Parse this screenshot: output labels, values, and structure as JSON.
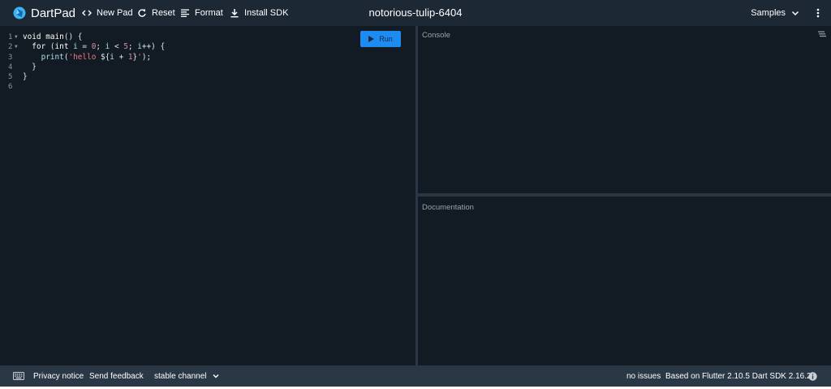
{
  "header": {
    "logo_text": "DartPad",
    "new_pad_label": "New Pad",
    "reset_label": "Reset",
    "format_label": "Format",
    "install_sdk_label": "Install SDK",
    "pad_title": "notorious-tulip-6404",
    "samples_label": "Samples"
  },
  "editor": {
    "run_label": "Run",
    "line_numbers": [
      "1",
      "2",
      "3",
      "4",
      "5",
      "6"
    ],
    "code": {
      "l1_kw": "void",
      "l1_fn": "main",
      "l1_rest": "() {",
      "l2_indent": "  ",
      "l2_for": "for",
      "l2_open": " (",
      "l2_int": "int",
      "l2_sp": " ",
      "l2_i1": "i",
      "l2_eq": " = ",
      "l2_zero": "0",
      "l2_semi1": "; ",
      "l2_i2": "i",
      "l2_lt": " < ",
      "l2_five": "5",
      "l2_semi2": "; ",
      "l2_i3": "i",
      "l2_end": "++) {",
      "l3_indent": "    ",
      "l3_print": "print",
      "l3_paren": "(",
      "l3_str1": "'hello ",
      "l3_interp_open": "${",
      "l3_i": "i",
      "l3_plus": " + ",
      "l3_one": "1",
      "l3_interp_close": "}",
      "l3_str2": "'",
      "l3_end": ");",
      "l4": "  }",
      "l5": "}",
      "l6": ""
    }
  },
  "console": {
    "label": "Console"
  },
  "documentation": {
    "label": "Documentation"
  },
  "footer": {
    "privacy_label": "Privacy notice",
    "feedback_label": "Send feedback",
    "channel_label": "stable channel",
    "issues_label": "no issues",
    "version_label": "Based on Flutter 2.10.5 Dart SDK 2.16.2"
  },
  "icons": {
    "logo": "dart-logo-icon",
    "new_pad": "code-brackets-icon",
    "reset": "refresh-icon",
    "format": "format-lines-icon",
    "install": "download-icon",
    "samples": "chevron-down-icon",
    "more": "more-vert-icon",
    "run": "play-icon",
    "console_clear": "clear-all-icon",
    "keyboard": "keyboard-icon",
    "channel": "chevron-down-icon",
    "info": "info-icon"
  },
  "colors": {
    "header_bg": "#1c2834",
    "panel_bg": "#121a23",
    "footer_bg": "#2a3744",
    "run_button": "#1d8bf0",
    "string": "#f07a7a",
    "identifier": "#a7e1ea",
    "number": "#d68fa8"
  }
}
